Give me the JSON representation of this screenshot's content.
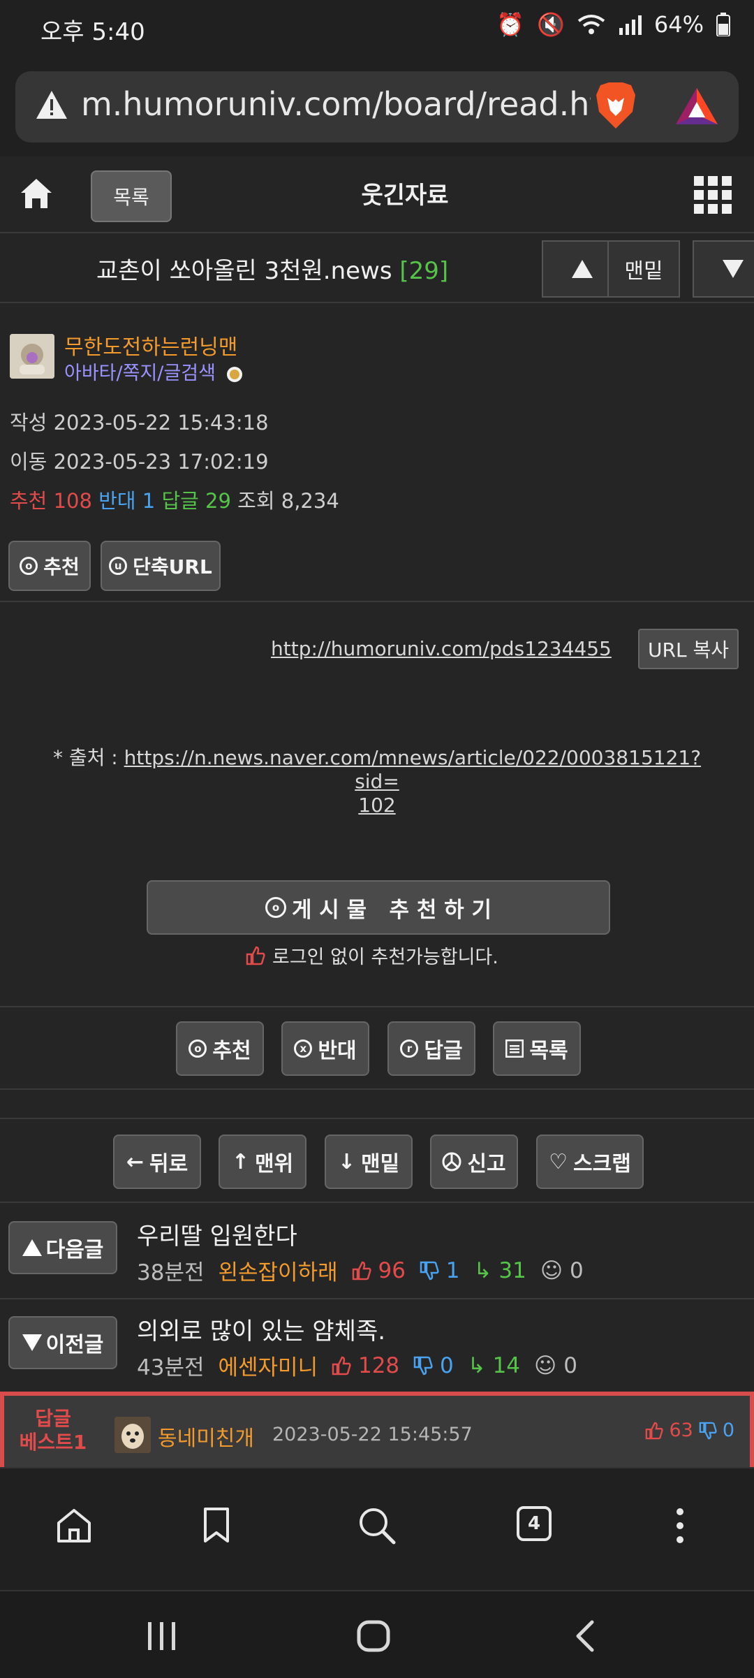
{
  "status_bar": {
    "time": "오후 5:40",
    "battery": "64%"
  },
  "browser": {
    "url": "m.humoruniv.com/board/read.htm",
    "tabs_count": "4"
  },
  "site_header": {
    "list_label": "목록",
    "title": "웃긴자료"
  },
  "post": {
    "title": "교촌이 쏘아올린 3천원.news",
    "reply_count": "[29]",
    "bottom_label": "맨밑",
    "author": "무한도전하는런닝맨",
    "author_menu": "아바타/쪽지/글검색",
    "written": "작성 2023-05-22 15:43:18",
    "moved": "이동 2023-05-23 17:02:19",
    "stats": {
      "rec_label": "추천",
      "rec": "108",
      "opp_label": "반대",
      "opp": "1",
      "reply_label": "답글",
      "reply": "29",
      "view_label": "조회",
      "view": "8,234"
    },
    "btn_recommend": "추천",
    "btn_short_url": "단축URL",
    "pds_url": "http://humoruniv.com/pds1234455",
    "copy_url": "URL 복사",
    "source_prefix": "* 출처 : ",
    "source_line1": "https://n.news.naver.com/mnews/article/022/0003815121?sid=",
    "source_line2": "102",
    "recommend_big": "게 시 물   추 천 하 기",
    "login_note": "로그인 없이 추천가능합니다."
  },
  "actions": {
    "recommend": "추천",
    "oppose": "반대",
    "reply": "답글",
    "list": "목록"
  },
  "nav_actions": {
    "back": "뒤로",
    "top": "맨위",
    "bottom": "맨밑",
    "report": "신고",
    "scrap": "스크랩"
  },
  "next_post": {
    "label": "다음글",
    "title": "우리딸 입원한다",
    "time": "38분전",
    "author": "왼손잡이하래",
    "up": "96",
    "down": "1",
    "replies": "31",
    "comments": "0"
  },
  "prev_post": {
    "label": "이전글",
    "title": "의외로 많이 있는 얌체족.",
    "time": "43분전",
    "author": "에센자미니",
    "up": "128",
    "down": "0",
    "replies": "14",
    "comments": "0"
  },
  "best_reply": {
    "badge_line1": "답글",
    "badge_line2": "베스트1",
    "author": "동네미친개",
    "datetime": "2023-05-22 15:45:57",
    "up": "63",
    "down": "0"
  },
  "colors": {
    "accent_orange": "#f29b2c",
    "red": "#e24b4b",
    "blue": "#4aa3f0",
    "green": "#56c34a",
    "best_border": "#d94c4c"
  }
}
